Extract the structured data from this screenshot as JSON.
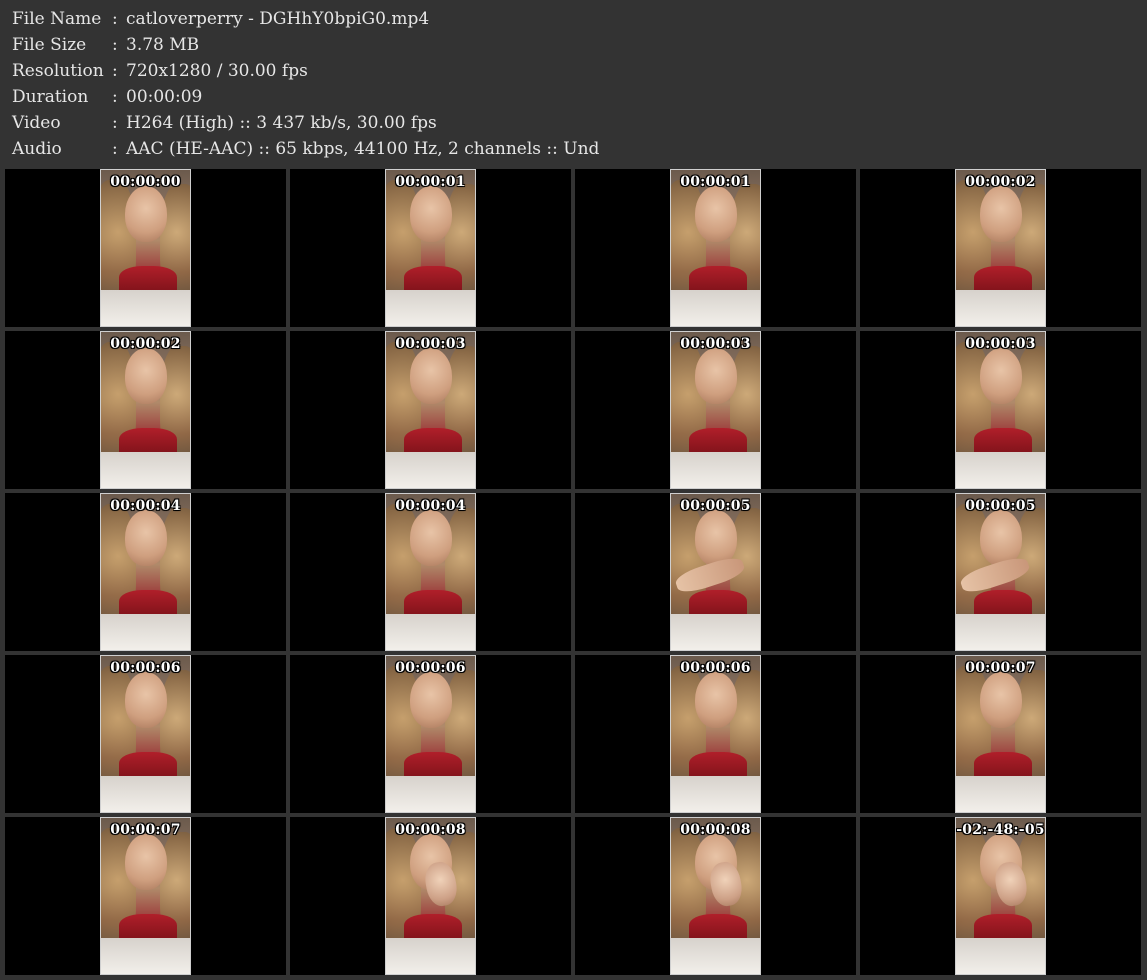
{
  "metadata": [
    {
      "key": "File Name",
      "value": "catloverperry - DGHhY0bpiG0.mp4"
    },
    {
      "key": "File Size",
      "value": "3.78 MB"
    },
    {
      "key": "Resolution",
      "value": "720x1280 / 30.00 fps"
    },
    {
      "key": "Duration",
      "value": "00:00:09"
    },
    {
      "key": "Video",
      "value": "H264 (High) :: 3 437 kb/s, 30.00 fps"
    },
    {
      "key": "Audio",
      "value": "AAC (HE-AAC) :: 65 kbps, 44100 Hz, 2 channels :: Und"
    }
  ],
  "separator": ":",
  "thumbnails": [
    {
      "time": "00:00:00",
      "variant": "face"
    },
    {
      "time": "00:00:01",
      "variant": "face"
    },
    {
      "time": "00:00:01",
      "variant": "face"
    },
    {
      "time": "00:00:02",
      "variant": "face"
    },
    {
      "time": "00:00:02",
      "variant": "face"
    },
    {
      "time": "00:00:03",
      "variant": "face"
    },
    {
      "time": "00:00:03",
      "variant": "face"
    },
    {
      "time": "00:00:03",
      "variant": "face"
    },
    {
      "time": "00:00:04",
      "variant": "face"
    },
    {
      "time": "00:00:04",
      "variant": "face"
    },
    {
      "time": "00:00:05",
      "variant": "arm"
    },
    {
      "time": "00:00:05",
      "variant": "arm"
    },
    {
      "time": "00:00:06",
      "variant": "face"
    },
    {
      "time": "00:00:06",
      "variant": "face"
    },
    {
      "time": "00:00:06",
      "variant": "face"
    },
    {
      "time": "00:00:07",
      "variant": "face"
    },
    {
      "time": "00:00:07",
      "variant": "face"
    },
    {
      "time": "00:00:08",
      "variant": "hand"
    },
    {
      "time": "00:00:08",
      "variant": "hand"
    },
    {
      "time": "-02:-48:-05",
      "variant": "hand"
    }
  ],
  "colors": {
    "background": "#333333",
    "cell_background": "#000000",
    "text": "#e6e6e6",
    "frame_border": "#cfcfcf"
  }
}
